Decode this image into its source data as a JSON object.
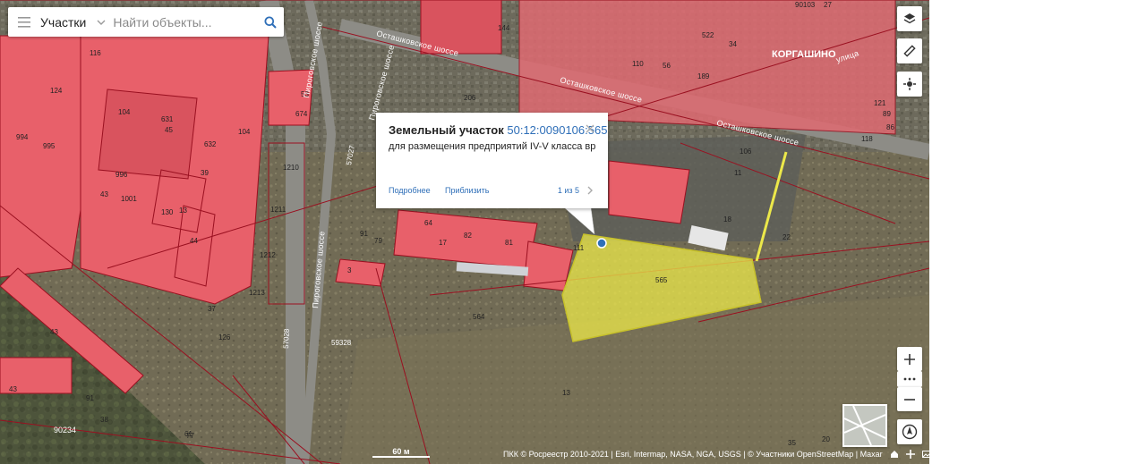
{
  "search": {
    "layer_label": "Участки",
    "placeholder": "Найти объекты...",
    "value": ""
  },
  "popup": {
    "title": "Земельный участок",
    "cadastral_number": "50:12:0090106:565",
    "description": "для размещения предприятий IV-V класса вр...",
    "details_link": "Подробнее",
    "zoom_link": "Приблизить",
    "pager": "1 из 5"
  },
  "map": {
    "streets": [
      "Осташковское шоссе",
      "Осташковское шоссе",
      "Осташковское шоссе",
      "Пироговское шоссе",
      "Пироговское шоссе",
      "Пироговское шоссе",
      "улица"
    ],
    "place_label": "КОРГАШИНО",
    "quarter_labels": [
      "90103",
      "90234",
      "57028",
      "57027",
      "59328"
    ],
    "selected_parcel_label": "565",
    "parcel_labels": [
      "144",
      "116",
      "124",
      "104",
      "994",
      "995",
      "996",
      "632",
      "631",
      "45",
      "53",
      "674",
      "1210",
      "1211",
      "1212",
      "1213",
      "206",
      "104",
      "110",
      "56",
      "522",
      "34",
      "189",
      "121",
      "89",
      "86",
      "118",
      "106",
      "11",
      "18",
      "22",
      "17",
      "82",
      "81",
      "91",
      "79",
      "64",
      "3",
      "564",
      "13",
      "43",
      "130",
      "38",
      "37",
      "43",
      "43",
      "91",
      "61",
      "111",
      "1001",
      "44",
      "39",
      "27",
      "20",
      "13",
      "126",
      "77",
      "35"
    ],
    "colors": {
      "parcel_fill": "#e8606a",
      "parcel_border": "#9a1020",
      "selected_fill": "#ece84a",
      "link": "#2f6fb8"
    }
  },
  "scale": {
    "label": "60 м"
  },
  "attribution": "ПКК © Росреестр 2010-2021 | Esri, Intermap, NASA, NGA, USGS | © Участники OpenStreetMap | Maxar",
  "controls": {
    "layers": "layers-icon",
    "measure": "ruler-icon",
    "locate": "crosshair-icon",
    "zoom_in": "plus-icon",
    "more": "dots-icon",
    "zoom_out": "minus-icon",
    "compass": "compass-icon"
  }
}
